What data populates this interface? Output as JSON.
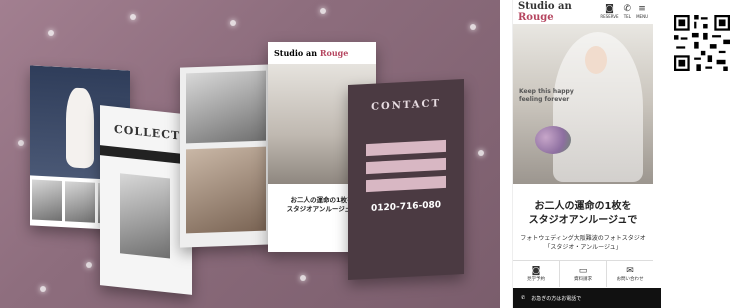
{
  "brand": {
    "name_a": "Studio an ",
    "name_b": "Rouge"
  },
  "phone": {
    "header_icons": [
      {
        "glyph": "◙",
        "label": "RESERVE"
      },
      {
        "glyph": "✆",
        "label": "TEL"
      },
      {
        "glyph": "≡",
        "label": "MENU"
      }
    ],
    "hero_tagline": [
      "Keep this happy",
      "feeling forever"
    ],
    "title_line1": "お二人の運命の1枚を",
    "title_line2": "スタジオアンルージュで",
    "subtitle_line1": "フォトウェディング大阪難波のフォトスタジオ",
    "subtitle_line2": "「スタジオ・アンルージュ」",
    "nav": [
      {
        "glyph": "◙",
        "label": "見学予約"
      },
      {
        "glyph": "▭",
        "label": "資料請求"
      },
      {
        "glyph": "✉",
        "label": "お問い合わせ"
      }
    ],
    "bottom_bar": "お急ぎの方はお電話で"
  },
  "mockups": {
    "collection": "COLLECTION",
    "contact": "CONTACT",
    "phone_number": "0120-716-080",
    "screen_title_line1": "お二人の運命の1枚を",
    "screen_title_line2": "スタジオアンルージュで"
  },
  "colors": {
    "accent": "#b5455f",
    "hero_bg": "#8d6d7d"
  }
}
